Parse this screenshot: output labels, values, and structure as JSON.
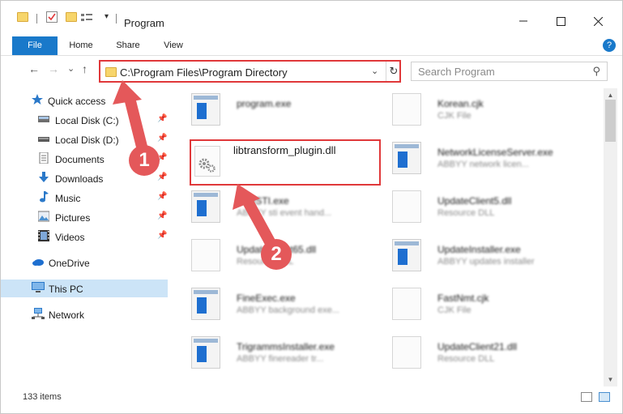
{
  "window": {
    "title": "Program"
  },
  "ribbon": {
    "tabs": [
      "File",
      "Home",
      "Share",
      "View"
    ],
    "help": "?"
  },
  "navbar": {
    "back": "←",
    "forward": "→",
    "recent": "⌄",
    "up": "↑",
    "address": "C:\\Program Files\\Program Directory",
    "dropdown": "⌄",
    "refresh": "↻",
    "search_placeholder": "Search Program",
    "search_icon": "⚲"
  },
  "sidebar": {
    "items": [
      {
        "label": "Quick access",
        "icon": "star-icon"
      },
      {
        "label": "Local Disk (C:)",
        "icon": "drive-icon",
        "pinned": true
      },
      {
        "label": "Local Disk (D:)",
        "icon": "drive-icon",
        "pinned": true
      },
      {
        "label": "Documents",
        "icon": "documents-icon",
        "pinned": true
      },
      {
        "label": "Downloads",
        "icon": "downloads-icon",
        "pinned": true
      },
      {
        "label": "Music",
        "icon": "music-icon",
        "pinned": true
      },
      {
        "label": "Pictures",
        "icon": "pictures-icon",
        "pinned": true
      },
      {
        "label": "Videos",
        "icon": "videos-icon",
        "pinned": true
      },
      {
        "label": "OneDrive",
        "icon": "cloud-icon"
      },
      {
        "label": "This PC",
        "icon": "pc-icon",
        "selected": true
      },
      {
        "label": "Network",
        "icon": "network-icon"
      }
    ]
  },
  "files": [
    {
      "name": "program.exe",
      "desc": "",
      "type": "exe"
    },
    {
      "name": "Korean.cjk",
      "desc": "CJK File",
      "type": "doc"
    },
    {
      "name": "libtransform_plugin.dll",
      "desc": "",
      "type": "dll",
      "highlighted": true
    },
    {
      "name": "NetworkLicenseServer.exe",
      "desc": "ABBYY network licen...",
      "type": "exe"
    },
    {
      "name": "FineSTI.exe",
      "desc": "ABBYY sti event hand...",
      "type": "exe"
    },
    {
      "name": "UpdateClient5.dll",
      "desc": "Resource DLL",
      "type": "dll"
    },
    {
      "name": "UpdateClient65.dll",
      "desc": "Resource DLL",
      "type": "dll"
    },
    {
      "name": "UpdateInstaller.exe",
      "desc": "ABBYY updates installer",
      "type": "exe"
    },
    {
      "name": "FineExec.exe",
      "desc": "ABBYY background exe...",
      "type": "exe"
    },
    {
      "name": "FastNmt.cjk",
      "desc": "CJK File",
      "type": "doc"
    },
    {
      "name": "TrigrammsInstaller.exe",
      "desc": "ABBYY finereader tr...",
      "type": "exe"
    },
    {
      "name": "UpdateClient21.dll",
      "desc": "Resource DLL",
      "type": "dll"
    }
  ],
  "status": {
    "count": "133 items"
  },
  "annotations": {
    "step1": "1",
    "step2": "2"
  },
  "colors": {
    "accent": "#1979ca",
    "highlight_red": "#e0383a",
    "annotation_red": "#e4585a",
    "selected_bg": "#cce4f7"
  }
}
